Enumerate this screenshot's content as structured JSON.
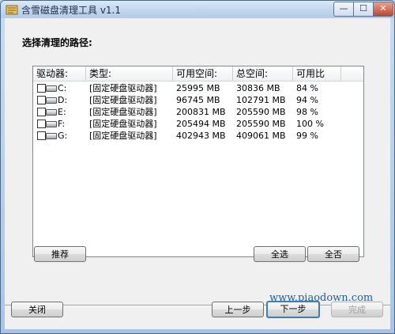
{
  "window": {
    "title": "含雪磁盘清理工具 v1.1",
    "minimize_label": "—",
    "maximize_label": "☐",
    "close_label": "✕"
  },
  "main": {
    "heading": "选择清理的路径:"
  },
  "drive_list": {
    "columns": [
      "驱动器:",
      "类型:",
      "可用空间:",
      "总空间:",
      "可用比"
    ],
    "rows": [
      {
        "drive": "C:",
        "type": "[固定硬盘驱动器]",
        "free": "25995 MB",
        "total": "30836 MB",
        "ratio": "84 %"
      },
      {
        "drive": "D:",
        "type": "[固定硬盘驱动器]",
        "free": "96745 MB",
        "total": "102791 MB",
        "ratio": "94 %"
      },
      {
        "drive": "E:",
        "type": "[固定硬盘驱动器]",
        "free": "200831 MB",
        "total": "205590 MB",
        "ratio": "98 %"
      },
      {
        "drive": "F:",
        "type": "[固定硬盘驱动器]",
        "free": "205494 MB",
        "total": "205590 MB",
        "ratio": "100 %"
      },
      {
        "drive": "G:",
        "type": "[固定硬盘驱动器]",
        "free": "402943 MB",
        "total": "409061 MB",
        "ratio": "99 %"
      }
    ]
  },
  "buttons": {
    "recommend": "推荐",
    "select_all": "全选",
    "select_none": "全否",
    "close": "关闭",
    "prev": "上一步",
    "next": "下一步",
    "finish": "完成"
  },
  "watermark": "www.piaodown.com",
  "colors": {
    "title_gradient_top": "#dce9f7",
    "client_bg": "#f0f0f0",
    "watermark": "#1b5fb7",
    "close_button": "#c4442c"
  },
  "icons": {
    "app": "broom-icon",
    "drive": "hard-drive-icon"
  }
}
